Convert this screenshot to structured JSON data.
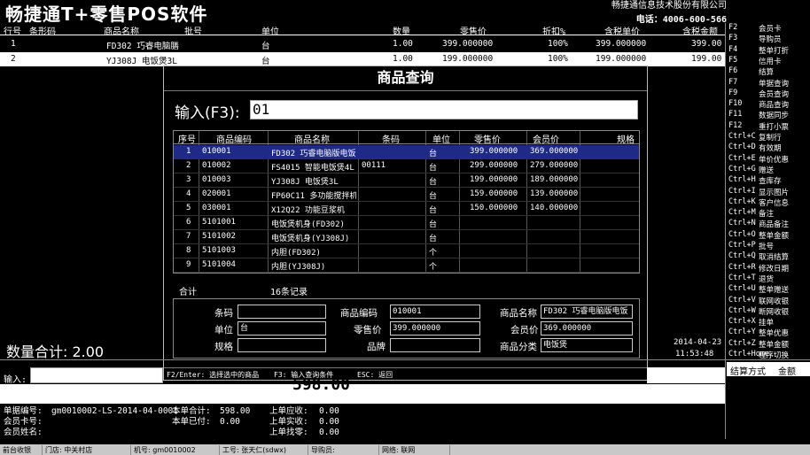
{
  "app": {
    "title": "畅捷通T+零售POS软件",
    "company": "畅捷通信息技术股份有限公司",
    "phone": "电话：4006-600-566"
  },
  "sale_grid": {
    "headers": [
      "行号",
      "条形码",
      "商品名称",
      "批号",
      "单位",
      "数量",
      "零售价",
      "折扣%",
      "含税单价",
      "含税金额"
    ],
    "rows": [
      {
        "no": "1",
        "name": "FD302 巧睿电脑膳",
        "unit": "台",
        "qty": "1.00",
        "price": "399.000000",
        "discount": "100%",
        "tax_price": "399.000000",
        "amount": "399.00"
      },
      {
        "no": "2",
        "name": "YJ308J 电饭煲3L",
        "unit": "台",
        "qty": "1.00",
        "price": "199.000000",
        "discount": "100%",
        "tax_price": "199.000000",
        "amount": "199.00"
      }
    ]
  },
  "fn_keys": [
    {
      "key": "F2",
      "label": "会员卡"
    },
    {
      "key": "F3",
      "label": "导购员"
    },
    {
      "key": "F4",
      "label": "整单打折"
    },
    {
      "key": "F5",
      "label": "信用卡"
    },
    {
      "key": "F6",
      "label": "结算"
    },
    {
      "key": "F7",
      "label": "单据查询"
    },
    {
      "key": "F9",
      "label": "会员查询"
    },
    {
      "key": "F10",
      "label": "商品查询"
    },
    {
      "key": "F11",
      "label": "数据同步"
    },
    {
      "key": "F12",
      "label": "重打小票"
    },
    {
      "key": "Ctrl+C",
      "label": "复制行"
    },
    {
      "key": "Ctrl+D",
      "label": "有效期"
    },
    {
      "key": "Ctrl+E",
      "label": "单价优惠"
    },
    {
      "key": "Ctrl+G",
      "label": "赠送"
    },
    {
      "key": "Ctrl+H",
      "label": "查库存"
    },
    {
      "key": "Ctrl+I",
      "label": "显示图片"
    },
    {
      "key": "Ctrl+K",
      "label": "客户信息"
    },
    {
      "key": "Ctrl+M",
      "label": "备注"
    },
    {
      "key": "Ctrl+N",
      "label": "商品备注"
    },
    {
      "key": "Ctrl+O",
      "label": "整单金额"
    },
    {
      "key": "Ctrl+P",
      "label": "批号"
    },
    {
      "key": "Ctrl+Q",
      "label": "取消结算"
    },
    {
      "key": "Ctrl+R",
      "label": "修改日期"
    },
    {
      "key": "Ctrl+T",
      "label": "退货"
    },
    {
      "key": "Ctrl+U",
      "label": "整单赠送"
    },
    {
      "key": "Ctrl+V",
      "label": "联网收银"
    },
    {
      "key": "Ctrl+W",
      "label": "断网收银"
    },
    {
      "key": "Ctrl+X",
      "label": "挂单"
    },
    {
      "key": "Ctrl+Y",
      "label": "整单优惠"
    },
    {
      "key": "Ctrl+Z",
      "label": "整单金额"
    },
    {
      "key": "Ctrl+Home",
      "label": "程序切换"
    }
  ],
  "dialog": {
    "title": "商品查询",
    "input_label": "输入(F3):",
    "input_value": "01",
    "headers": [
      "序号",
      "商品编码",
      "商品名称",
      "条码",
      "单位",
      "零售价",
      "会员价",
      "规格"
    ],
    "rows": [
      {
        "no": "1",
        "code": "010001",
        "name": "FD302 巧睿电脑版电饭",
        "barcode": "",
        "unit": "台",
        "price": "399.000000",
        "member": "369.000000"
      },
      {
        "no": "2",
        "code": "010002",
        "name": "FS4015 智能电饭煲4L",
        "barcode": "00111",
        "unit": "台",
        "price": "299.000000",
        "member": "279.000000"
      },
      {
        "no": "3",
        "code": "010003",
        "name": "YJ308J 电饭煲3L",
        "barcode": "",
        "unit": "台",
        "price": "199.000000",
        "member": "189.000000"
      },
      {
        "no": "4",
        "code": "020001",
        "name": "FP60C11 多功能搅拌机",
        "barcode": "",
        "unit": "台",
        "price": "159.000000",
        "member": "139.000000"
      },
      {
        "no": "5",
        "code": "030001",
        "name": "X12Q22 功能豆浆机",
        "barcode": "",
        "unit": "台",
        "price": "150.000000",
        "member": "140.000000"
      },
      {
        "no": "6",
        "code": "5101001",
        "name": "电饭煲机身(FD302)",
        "barcode": "",
        "unit": "台",
        "price": "",
        "member": ""
      },
      {
        "no": "7",
        "code": "5101002",
        "name": "电饭煲机身(YJ308J)",
        "barcode": "",
        "unit": "台",
        "price": "",
        "member": ""
      },
      {
        "no": "8",
        "code": "5101003",
        "name": "内胆(FD302)",
        "barcode": "",
        "unit": "个",
        "price": "",
        "member": ""
      },
      {
        "no": "9",
        "code": "5101004",
        "name": "内胆(YJ308J)",
        "barcode": "",
        "unit": "个",
        "price": "",
        "member": ""
      }
    ],
    "total_label": "合计",
    "total_value": "16条记录",
    "detail": {
      "barcode_label": "条码",
      "barcode": "",
      "code_label": "商品编码",
      "code": "010001",
      "name_label": "商品名称",
      "name": "FD302 巧睿电脑版电饭",
      "unit_label": "单位",
      "unit": "台",
      "price_label": "零售价",
      "price": "399.000000",
      "member_label": "会员价",
      "member": "369.000000",
      "spec_label": "规格",
      "spec": "",
      "brand_label": "品牌",
      "brand": "",
      "category_label": "商品分类",
      "category": "电饭煲"
    },
    "status": [
      "F2/Enter: 选择选中的商品",
      "F3: 输入查询条件",
      "ESC: 返回"
    ]
  },
  "bottom": {
    "qty_total": "数量合计: 2.00",
    "date": "2014-04-23",
    "time": "11:53:48",
    "settle_tabs": [
      "结算方式",
      "金额"
    ],
    "input_label": "输入:",
    "change_big": "598.00",
    "info": {
      "doc_no_label": "单据编号:",
      "doc_no": "gm0010002-LS-2014-04-0001",
      "member_card_label": "会员卡号:",
      "member_name_label": "会员姓名:",
      "total_label": "本单合计:",
      "total": "598.00",
      "paid_label": "本单已付:",
      "paid": "0.00",
      "prev_due_label": "上单应收:",
      "prev_due": "0.00",
      "prev_paid_label": "上单实收:",
      "prev_paid": "0.00",
      "prev_change_label": "上单找零:",
      "prev_change": "0.00"
    }
  },
  "status_bar": {
    "items": [
      "前台收银",
      "门店: 中关村店",
      "机号: gm0010002",
      "工号: 张天仁(sdwx)",
      "导购员:",
      "网络: 联网"
    ]
  }
}
